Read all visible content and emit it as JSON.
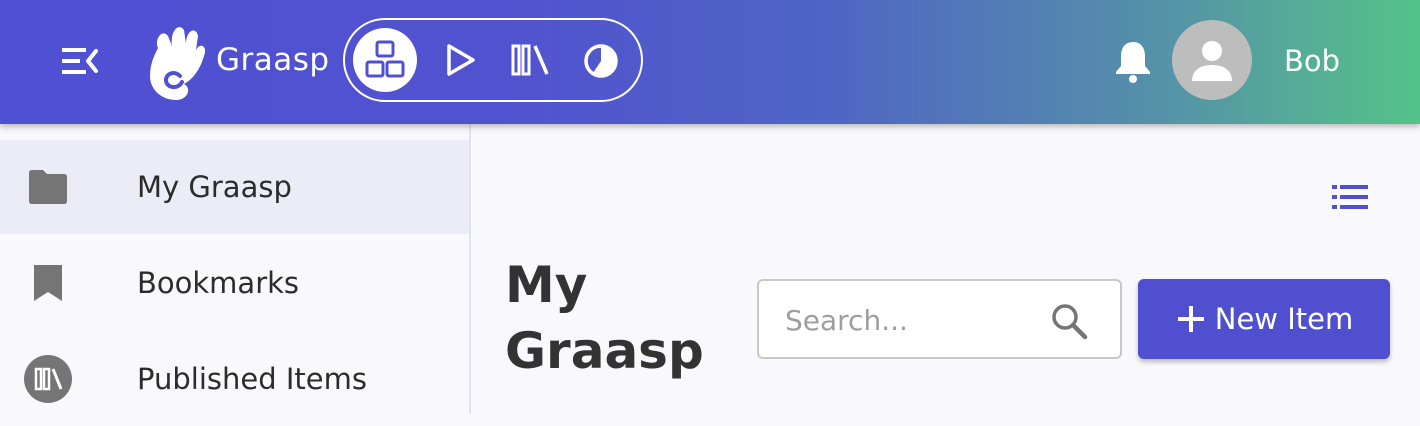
{
  "header": {
    "brand": "Graasp",
    "user_name": "Bob",
    "platforms": [
      {
        "name": "Builder",
        "icon": "builder-icon",
        "active": true
      },
      {
        "name": "Player",
        "icon": "player-icon",
        "active": false
      },
      {
        "name": "Library",
        "icon": "library-icon",
        "active": false
      },
      {
        "name": "Analytics",
        "icon": "analytics-icon",
        "active": false
      }
    ],
    "colors": {
      "gradient_start": "#5050d2",
      "gradient_end": "#55c289"
    }
  },
  "sidebar": {
    "items": [
      {
        "label": "My Graasp",
        "icon": "folder-icon",
        "selected": true
      },
      {
        "label": "Bookmarks",
        "icon": "bookmark-icon",
        "selected": false
      },
      {
        "label": "Published Items",
        "icon": "library-icon",
        "selected": false
      }
    ]
  },
  "main": {
    "title": "My Graasp",
    "search": {
      "placeholder": "Search...",
      "value": ""
    },
    "new_item_label": "New Item",
    "view_mode_icon": "list-view-icon",
    "accent_color": "#4f4fd0"
  }
}
